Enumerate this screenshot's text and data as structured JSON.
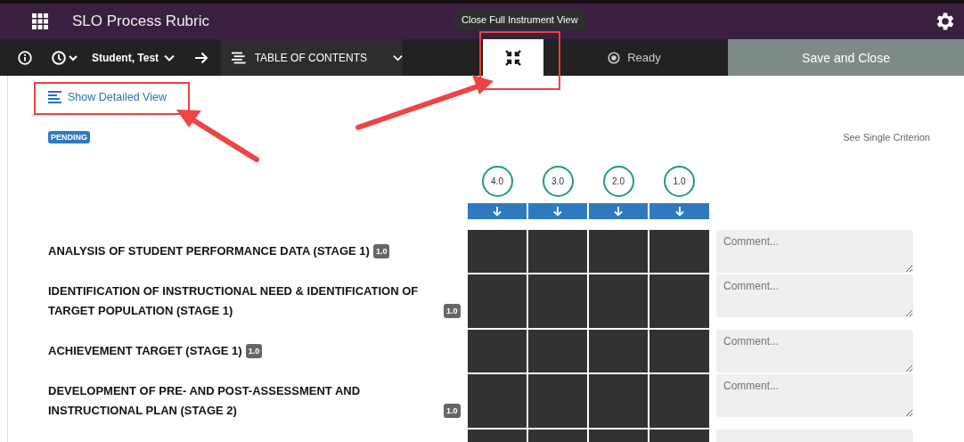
{
  "app_bar": {
    "title": "SLO Process Rubric"
  },
  "tooltip": "Close Full Instrument View",
  "toolbar": {
    "student": "Student, Test",
    "toc": "TABLE OF CONTENTS",
    "status": "Ready",
    "save": "Save and Close"
  },
  "detail_link": "Show Detailed View",
  "status_badge": "PENDING",
  "single_link": "See Single Criterion",
  "levels": [
    "4.0",
    "3.0",
    "2.0",
    "1.0"
  ],
  "criteria": [
    {
      "title": "ANALYSIS OF STUDENT PERFORMANCE DATA (STAGE 1)",
      "weight": "1.0",
      "placeholder": "Comment..."
    },
    {
      "title": "IDENTIFICATION OF INSTRUCTIONAL NEED & IDENTIFICATION OF TARGET POPULATION (STAGE 1)",
      "weight": "1.0",
      "placeholder": "Comment..."
    },
    {
      "title": "ACHIEVEMENT TARGET (STAGE 1)",
      "weight": "1.0",
      "placeholder": "Comment..."
    },
    {
      "title": "DEVELOPMENT OF PRE- AND POST-ASSESSMENT AND INSTRUCTIONAL PLAN (STAGE 2)",
      "weight": "1.0",
      "placeholder": "Comment..."
    }
  ]
}
